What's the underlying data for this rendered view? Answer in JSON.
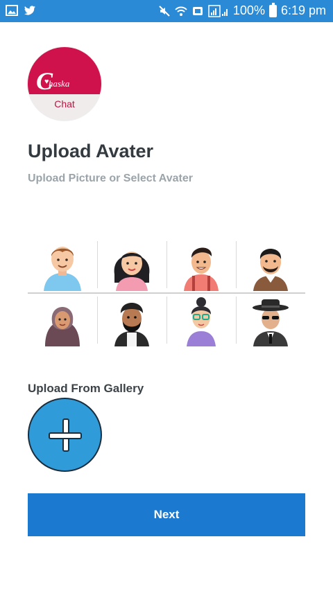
{
  "status_bar": {
    "battery_text": "100%",
    "time": "6:19 pm",
    "icons": [
      "gallery-icon",
      "twitter-icon",
      "mute-icon",
      "wifi-icon",
      "message-icon",
      "signal-icon",
      "battery-icon"
    ],
    "bg_color": "#2b8ad6"
  },
  "logo": {
    "initial": "C",
    "brand": "haska",
    "tagline": "Chat",
    "colors": {
      "primary": "#d0124c",
      "background": "#f1ecec"
    }
  },
  "page": {
    "title": "Upload Avater",
    "subtitle": "Upload Picture or Select Avater"
  },
  "avatars": [
    {
      "name": "avatar-boy-blue-shirt"
    },
    {
      "name": "avatar-girl-black-hair"
    },
    {
      "name": "avatar-man-suspenders"
    },
    {
      "name": "avatar-man-beard"
    },
    {
      "name": "avatar-woman-hijab"
    },
    {
      "name": "avatar-man-turban"
    },
    {
      "name": "avatar-woman-glasses"
    },
    {
      "name": "avatar-spy-hat"
    }
  ],
  "gallery": {
    "label": "Upload From Gallery",
    "button_icon": "plus-icon",
    "button_color": "#2f9bd8"
  },
  "actions": {
    "next_label": "Next",
    "next_color": "#1b79d0"
  }
}
